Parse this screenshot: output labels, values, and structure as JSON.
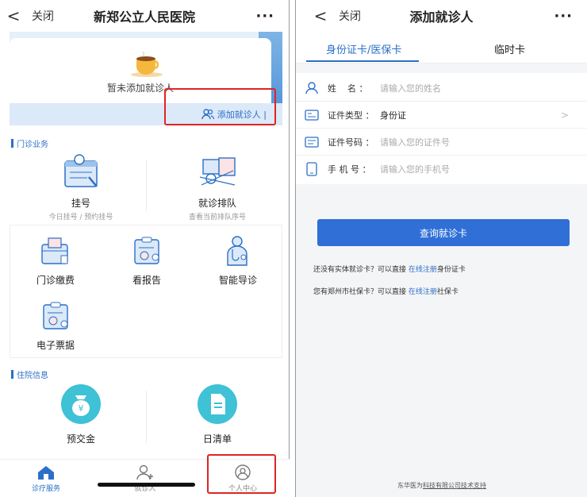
{
  "left": {
    "topbar": {
      "back": "<",
      "close": "关闭",
      "title": "新郑公立人民医院",
      "more": "···"
    },
    "hero": {
      "empty_text": "暂未添加就诊人",
      "add_label": "添加就诊人 |"
    },
    "outpatient": {
      "section_label": "门诊业务",
      "register": {
        "label": "挂号",
        "sub": "今日挂号 / 预约挂号"
      },
      "queue": {
        "label": "就诊排队",
        "sub": "查看当前排队序号"
      },
      "items": [
        {
          "label": "门诊缴费",
          "icon": "payment-icon"
        },
        {
          "label": "看报告",
          "icon": "report-icon"
        },
        {
          "label": "智能导诊",
          "icon": "doctor-icon"
        },
        {
          "label": "电子票据",
          "icon": "receipt-icon"
        }
      ]
    },
    "inpatient": {
      "section_label": "住院信息",
      "items": [
        {
          "label": "预交金",
          "icon": "money-bag-icon"
        },
        {
          "label": "日清单",
          "icon": "document-icon"
        }
      ]
    },
    "bottom_nav": [
      {
        "label": "诊疗服务",
        "icon": "home-icon"
      },
      {
        "label": "就诊人",
        "icon": "add-person-icon"
      },
      {
        "label": "个人中心",
        "icon": "profile-icon"
      }
    ],
    "colors": {
      "accent": "#2b6fc7",
      "highlight_box": "#e02424"
    }
  },
  "right": {
    "topbar": {
      "back": "<",
      "close": "关闭",
      "title": "添加就诊人",
      "more": "···"
    },
    "tabs": [
      "身份证卡/医保卡",
      "临时卡"
    ],
    "form": {
      "name": {
        "label": "姓    名 ：",
        "placeholder": "请输入您的姓名"
      },
      "id_type": {
        "label": "证件类型 ：",
        "value": "身份证"
      },
      "id_no": {
        "label": "证件号码 ：",
        "placeholder": "请输入您的证件号"
      },
      "phone": {
        "label": "手 机 号 ：",
        "placeholder": "请输入您的手机号"
      }
    },
    "query_button": "查询就诊卡",
    "hints": [
      {
        "pre": "还没有实体就诊卡？可以直接 ",
        "link": "在线注册",
        "post": "身份证卡"
      },
      {
        "pre": "您有郑州市社保卡？可以直接 ",
        "link": "在线注册",
        "post": "社保卡"
      }
    ],
    "footer": {
      "pre": "东华医为",
      "link": "科技有限公司技术支持"
    }
  }
}
